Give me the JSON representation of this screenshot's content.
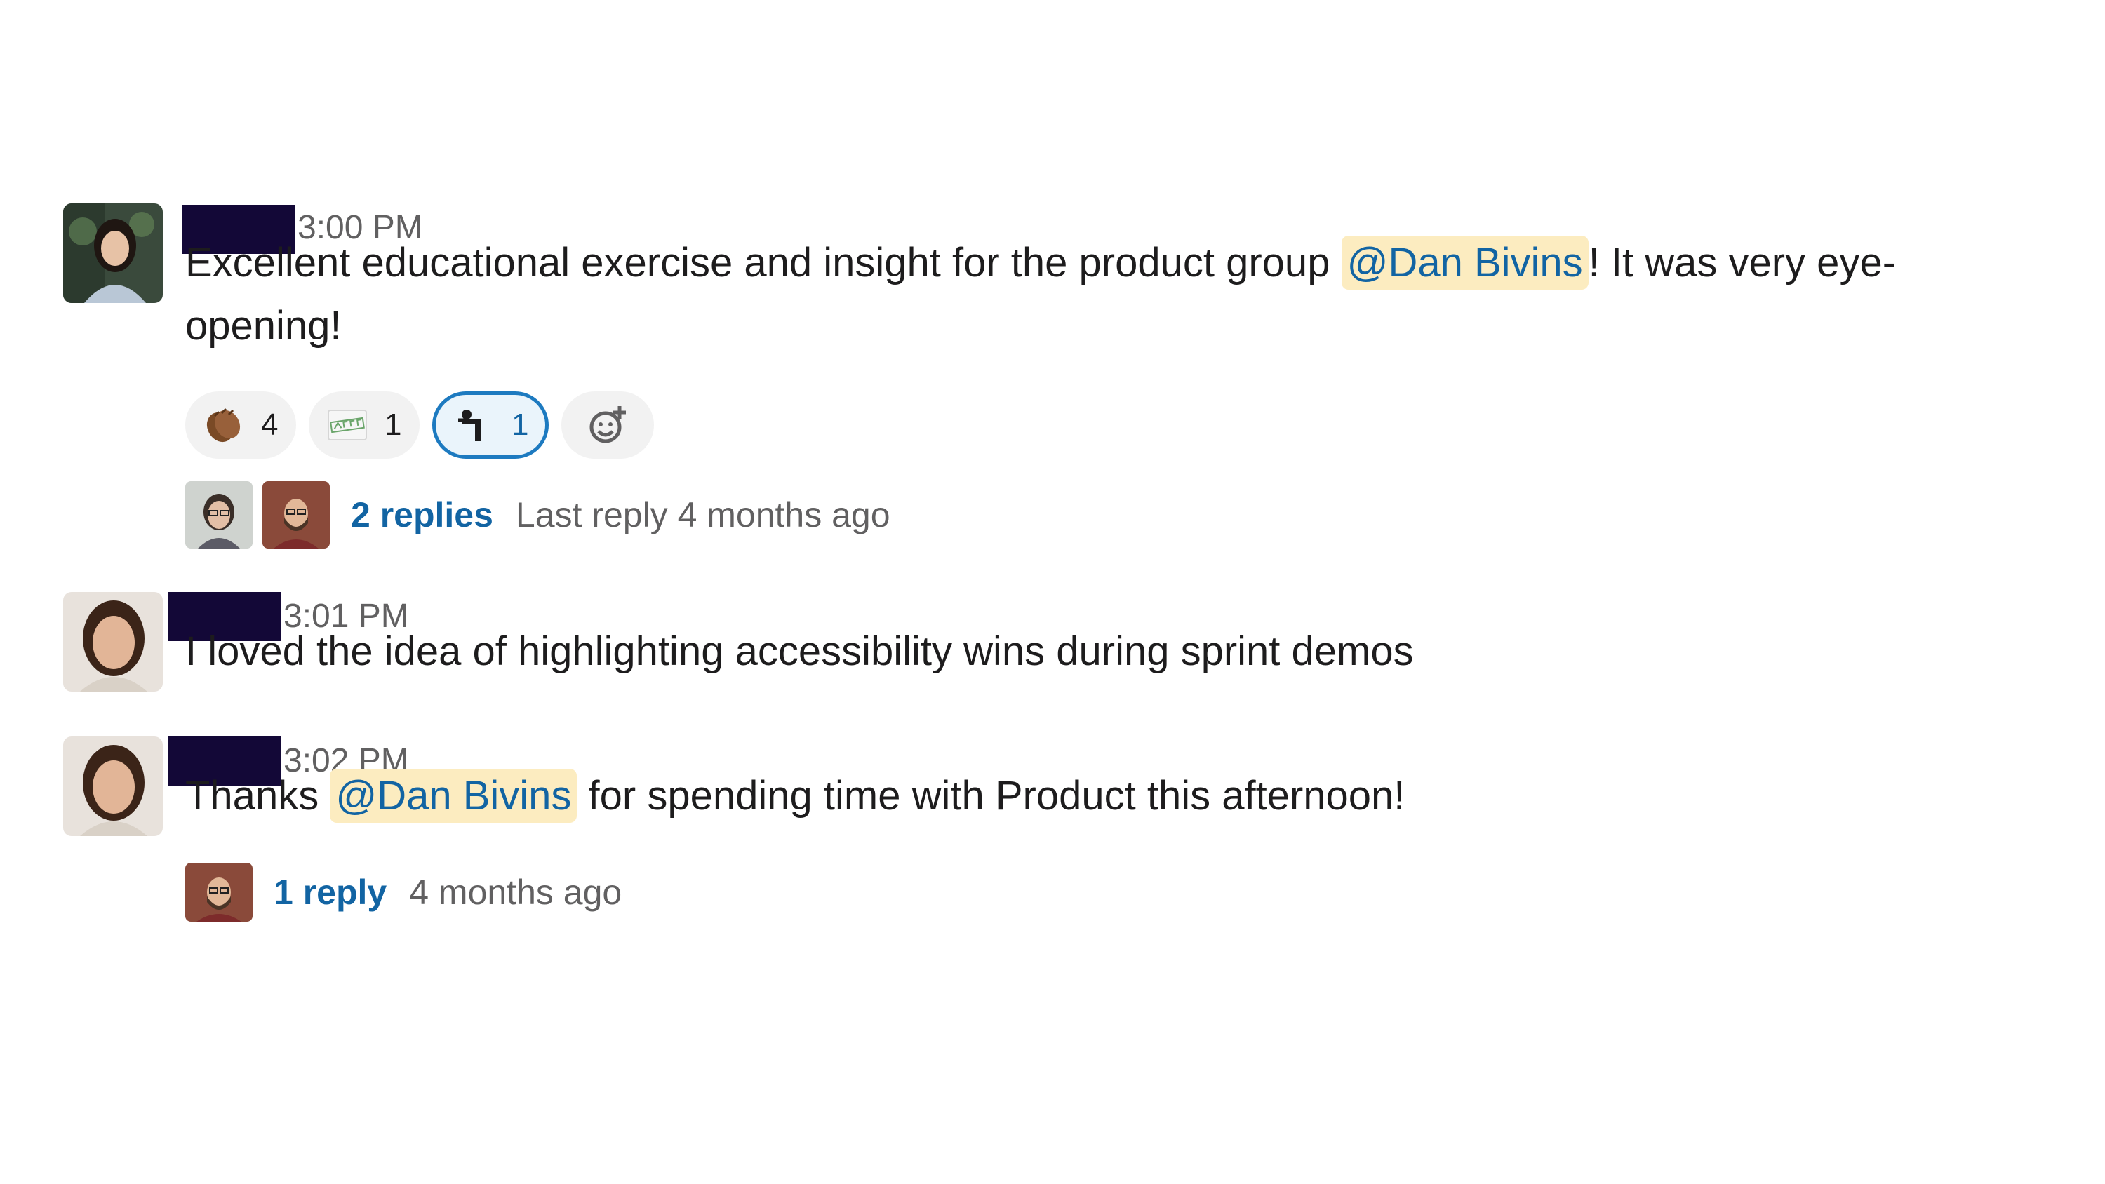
{
  "messages": [
    {
      "time": "3:00 PM",
      "text_before": "Excellent educational exercise and insight for the product group ",
      "mention": "@Dan Bivins",
      "text_after": "!  It was very eye-opening!",
      "reactions": [
        {
          "emoji": "clapping-hands-icon",
          "count": "4",
          "active": false
        },
        {
          "emoji": "agree-stamp-icon",
          "count": "1",
          "active": false
        },
        {
          "emoji": "bowing-figure-icon",
          "count": "1",
          "active": true
        }
      ],
      "add_reaction_icon": "add-reaction-icon",
      "thread": {
        "link": "2 replies",
        "meta": "Last reply 4 months ago"
      }
    },
    {
      "time": "3:01 PM",
      "text": "I loved the idea of highlighting accessibility wins during sprint demos"
    },
    {
      "time": "3:02 PM",
      "text_before": "Thanks ",
      "mention": "@Dan Bivins",
      "text_after": " for spending time with Product this afternoon!",
      "thread": {
        "link": "1 reply",
        "meta": "4 months ago"
      }
    }
  ],
  "colors": {
    "redaction": "#130837",
    "mention_bg": "#fcecc0",
    "link": "#1264a3",
    "active_reaction_border": "#1d7ac0"
  }
}
